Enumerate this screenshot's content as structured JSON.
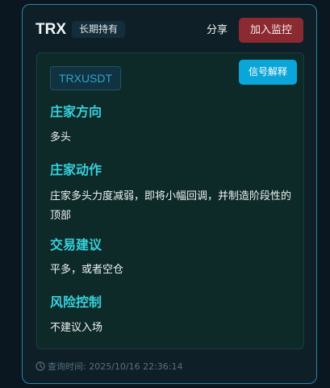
{
  "header": {
    "coin": "TRX",
    "badge": "长期持有",
    "share_label": "分享",
    "monitor_label": "加入监控"
  },
  "signal": {
    "symbol": "TRXUSDT",
    "explain_label": "信号解释",
    "sections": [
      {
        "title": "庄家方向",
        "text": "多头"
      },
      {
        "title": "庄家动作",
        "text": "庄家多头力度减弱，即将小幅回调，并制造阶段性的顶部"
      },
      {
        "title": "交易建议",
        "text": "平多，或者空仓"
      },
      {
        "title": "风险控制",
        "text": "不建议入场"
      }
    ]
  },
  "footer": {
    "query_time": "查询时间: 2025/10/16 22:36:14"
  },
  "colors": {
    "accent": "#37d0db",
    "monitor_button": "#8b2a30",
    "explain_button": "#0aa6d9",
    "card_border": "#2a87a6"
  },
  "icons": {
    "footer_icon": "clock-icon"
  }
}
